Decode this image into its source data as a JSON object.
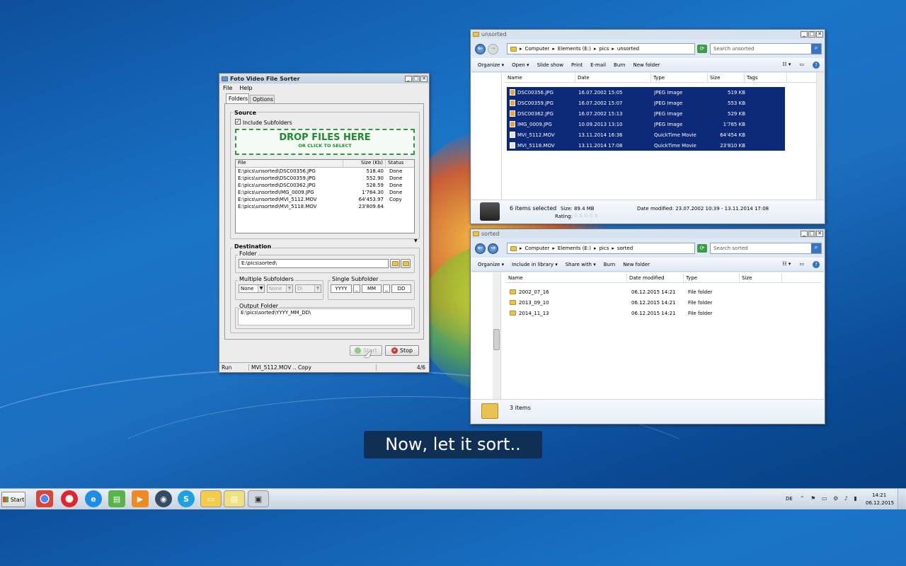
{
  "sorter": {
    "title": "Foto Video File Sorter",
    "menu": [
      "File",
      "Help"
    ],
    "tabs": [
      "Folders",
      "Options"
    ],
    "source_label": "Source",
    "include_subfolders": "Include Subfolders",
    "drop_title": "DROP FILES HERE",
    "drop_sub": "OR CLICK TO SELECT",
    "columns": [
      "File",
      "Size (Kb)",
      "Status"
    ],
    "files": [
      {
        "file": "E:\\pics\\unsorted\\DSC00356.JPG",
        "size": "518.40",
        "status": "Done"
      },
      {
        "file": "E:\\pics\\unsorted\\DSC00359.JPG",
        "size": "552.90",
        "status": "Done"
      },
      {
        "file": "E:\\pics\\unsorted\\DSC00362.JPG",
        "size": "528.59",
        "status": "Done"
      },
      {
        "file": "E:\\pics\\unsorted\\IMG_0009.JPG",
        "size": "1'764.30",
        "status": "Done"
      },
      {
        "file": "E:\\pics\\unsorted\\MVI_5112.MOV",
        "size": "64'453.97",
        "status": "Copy"
      },
      {
        "file": "E:\\pics\\unsorted\\MVI_5118.MOV",
        "size": "23'809.64",
        "status": ""
      }
    ],
    "destination_label": "Destination",
    "folder_label": "Folder",
    "folder_value": "E:\\pics\\sorted\\",
    "multiple_subfolders_label": "Multiple Subfolders",
    "multi_values": [
      "None",
      "None",
      "D\\"
    ],
    "single_subfolder_label": "Single Subfolder",
    "single_values": [
      "YYYY",
      "_",
      "MM",
      "_",
      "DD"
    ],
    "output_folder_label": "Output Folder",
    "output_folder_value": "E:\\pics\\sorted\\YYYY_MM_DD\\",
    "start_label": "Start",
    "stop_label": "Stop",
    "status_left": "Run",
    "status_mid": "MVI_5112.MOV .. Copy",
    "status_right": "4/6"
  },
  "unsorted": {
    "title": "unsorted",
    "breadcrumb": [
      "Computer",
      "Elements (E:)",
      "pics",
      "unsorted"
    ],
    "search_placeholder": "Search unsorted",
    "toolbar": [
      "Organize",
      "Open",
      "Slide show",
      "Print",
      "E-mail",
      "Burn",
      "New folder"
    ],
    "columns": [
      "Name",
      "Date",
      "Type",
      "Size",
      "Tags"
    ],
    "files": [
      {
        "name": "DSC00356.JPG",
        "date": "16.07.2002 15:05",
        "type": "JPEG Image",
        "size": "519 KB"
      },
      {
        "name": "DSC00359.JPG",
        "date": "16.07.2002 15:07",
        "type": "JPEG Image",
        "size": "553 KB"
      },
      {
        "name": "DSC00362.JPG",
        "date": "16.07.2002 15:13",
        "type": "JPEG Image",
        "size": "529 KB"
      },
      {
        "name": "IMG_0009.JPG",
        "date": "10.09.2013 13:10",
        "type": "JPEG Image",
        "size": "1'765 KB"
      },
      {
        "name": "MVI_5112.MOV",
        "date": "13.11.2014 16:36",
        "type": "QuickTime Movie",
        "size": "64'454 KB"
      },
      {
        "name": "MVI_5118.MOV",
        "date": "13.11.2014 17:08",
        "type": "QuickTime Movie",
        "size": "23'810 KB"
      }
    ],
    "details": {
      "selected": "6 items selected",
      "size": "Size: 89.4 MB",
      "date_modified": "Date modified: 23.07.2002 10:39 - 13.11.2014 17:08",
      "rating": "Rating:",
      "stars": "☆☆☆☆☆"
    }
  },
  "sorted": {
    "title": "sorted",
    "breadcrumb": [
      "Computer",
      "Elements (E:)",
      "pics",
      "sorted"
    ],
    "search_placeholder": "Search sorted",
    "toolbar": [
      "Organize",
      "Include in library",
      "Share with",
      "Burn",
      "New folder"
    ],
    "columns": [
      "Name",
      "Date modified",
      "Type",
      "Size"
    ],
    "folders": [
      {
        "name": "2002_07_16",
        "date": "06.12.2015 14:21",
        "type": "File folder"
      },
      {
        "name": "2013_09_10",
        "date": "06.12.2015 14:21",
        "type": "File folder"
      },
      {
        "name": "2014_11_13",
        "date": "06.12.2015 14:21",
        "type": "File folder"
      }
    ],
    "count": "3 items"
  },
  "subtitle": "Now, let it sort..",
  "taskbar": {
    "start": "Start",
    "lang": "DE",
    "time": "14:21",
    "date": "06.12.2015"
  },
  "colors": {
    "accent": "#1f8a2e",
    "selection": "#0c2a78",
    "subtitle_bg": "#0f2f55"
  }
}
